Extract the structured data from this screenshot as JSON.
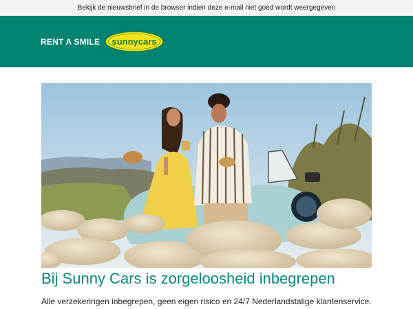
{
  "preheader": {
    "text": "Bekijk de nieuwsbrief in de browser indien deze e-mail niet goed wordt weergegeven"
  },
  "header": {
    "tagline": "RENT A SMILE",
    "logo_text": "sunnycars",
    "background_color": "#008370",
    "logo_color": "#f4e51b"
  },
  "hero": {
    "image_icon": "couple-with-convertible-and-sheep-photo"
  },
  "main": {
    "headline": "Bij Sunny Cars is zorgeloosheid inbegrepen",
    "intro": "Alle verzekeringen inbegrepen, geen eigen risico en 24/7 Nederlandstalige klantenservice."
  }
}
